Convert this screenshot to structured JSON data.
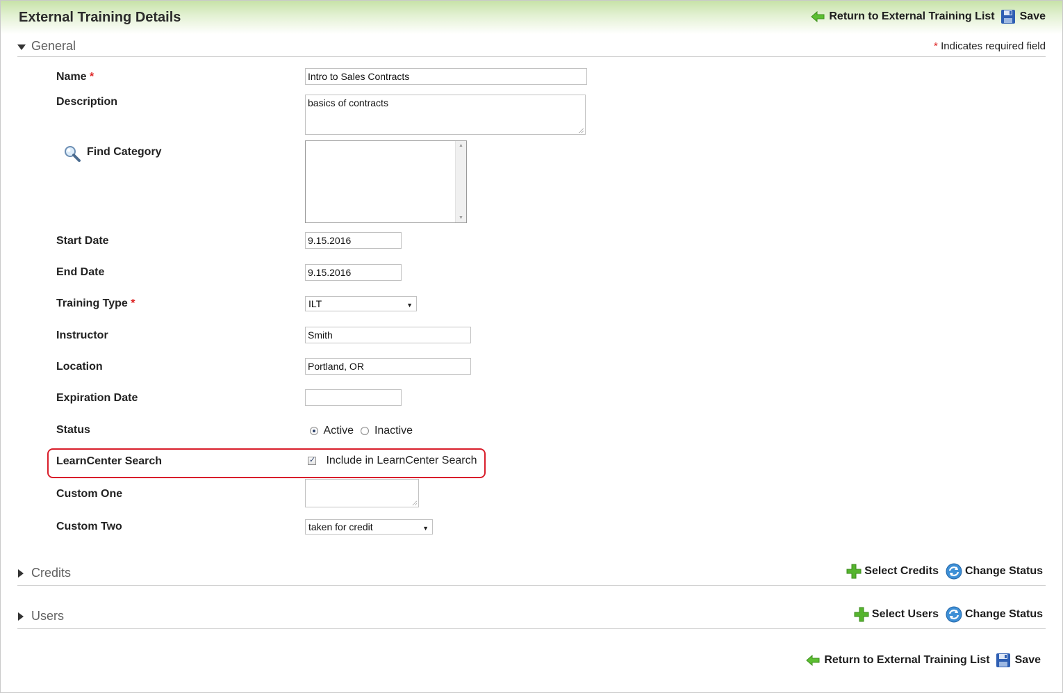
{
  "header": {
    "title": "External Training Details",
    "return_label": "Return to External Training List",
    "save_label": "Save"
  },
  "general": {
    "title": "General",
    "required_star": "*",
    "required_note": "Indicates required field"
  },
  "fields": {
    "name": {
      "label": "Name",
      "value": "Intro to Sales Contracts"
    },
    "description": {
      "label": "Description",
      "value": "basics of contracts"
    },
    "category": {
      "label": "Find Category"
    },
    "start_date": {
      "label": "Start Date",
      "value": "9.15.2016"
    },
    "end_date": {
      "label": "End Date",
      "value": "9.15.2016"
    },
    "training_type": {
      "label": "Training Type",
      "selected": "ILT"
    },
    "instructor": {
      "label": "Instructor",
      "value": "Smith"
    },
    "location": {
      "label": "Location",
      "value": "Portland, OR"
    },
    "expiration_date": {
      "label": "Expiration Date",
      "value": ""
    },
    "status": {
      "label": "Status",
      "options": [
        "Active",
        "Inactive"
      ],
      "selected": "Active"
    },
    "learncenter_search": {
      "label": "LearnCenter Search",
      "option_label": "Include in LearnCenter Search",
      "checked": true
    },
    "custom_one": {
      "label": "Custom One",
      "value": ""
    },
    "custom_two": {
      "label": "Custom Two",
      "selected": "taken for credit"
    }
  },
  "credits": {
    "title": "Credits",
    "select_label": "Select Credits",
    "change_status_label": "Change Status"
  },
  "users": {
    "title": "Users",
    "select_label": "Select Users",
    "change_status_label": "Change Status"
  },
  "footer": {
    "return_label": "Return to External Training List",
    "save_label": "Save"
  },
  "colors": {
    "header_gradient_top": "#c7e2a8",
    "required_star": "#dd2222",
    "highlight_border": "#d91e2b"
  },
  "icons": [
    "back-arrow-icon",
    "save-disk-icon",
    "magnifier-icon",
    "plus-icon",
    "refresh-icon",
    "triangle-down-icon",
    "triangle-right-icon"
  ]
}
